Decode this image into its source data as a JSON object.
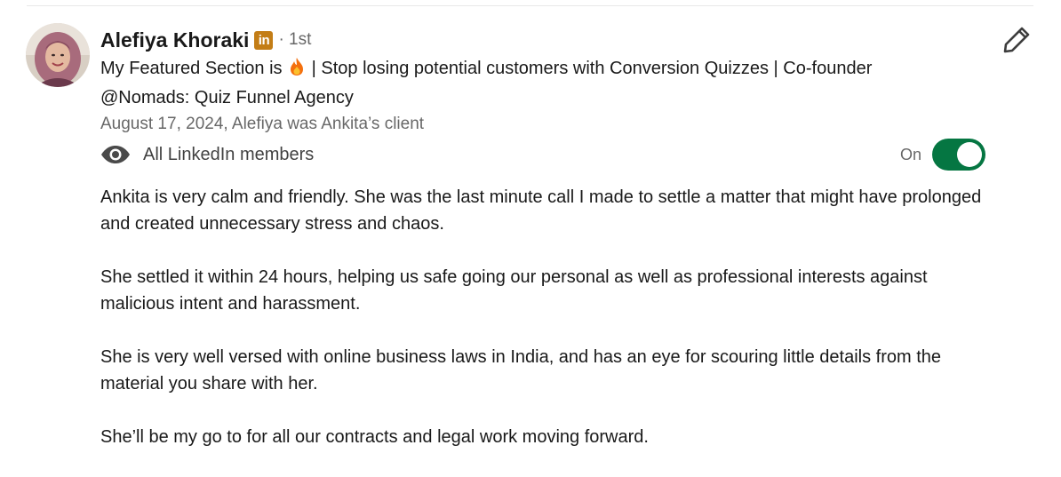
{
  "recommendation": {
    "author_name": "Alefiya Khoraki",
    "badge_icon": "linkedin-icon",
    "badge_text": "in",
    "connection_degree": "· 1st",
    "headline_part1": "My Featured Section is",
    "headline_emoji_icon": "fire-icon",
    "headline_part2": "| Stop losing potential customers with Conversion Quizzes | Co-founder @Nomads: Quiz Funnel Agency",
    "date_relationship": "August 17, 2024, Alefiya was Ankita’s client",
    "visibility": {
      "icon": "eye-icon",
      "label": "All LinkedIn members",
      "toggle_label": "On",
      "toggle_on": true
    },
    "edit_icon": "pencil-icon",
    "paragraphs": [
      "Ankita is very calm and friendly. She was the last minute call I made to settle a matter that might have prolonged and created unnecessary stress and chaos.",
      "She settled it within 24 hours, helping us safe going our personal as well as professional interests against malicious intent and harassment.",
      "She is very well versed with online business laws in India, and has an eye for scouring little details from the material you share with her.",
      "She’ll be my go to for all our contracts and legal work moving forward."
    ]
  },
  "colors": {
    "toggle_on": "#057642",
    "badge": "#c37d16",
    "muted_text": "#666666"
  }
}
